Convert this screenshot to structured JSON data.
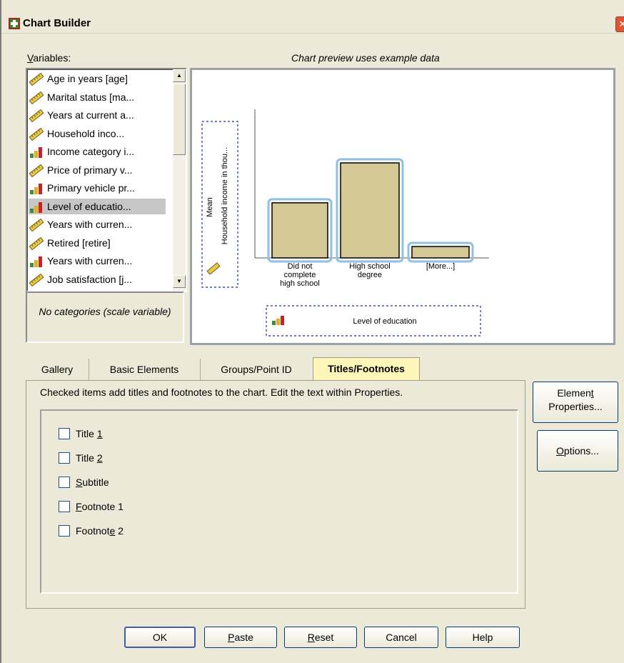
{
  "window": {
    "title": "Chart Builder",
    "close_glyph": "✕"
  },
  "variables": {
    "label": "Variables:",
    "items": [
      {
        "label": "Age in years [age]",
        "icon": "scale-ruler-icon"
      },
      {
        "label": "Marital status [ma...",
        "icon": "scale-ruler-icon"
      },
      {
        "label": "Years at current a...",
        "icon": "scale-ruler-icon"
      },
      {
        "label": "Household inco...",
        "icon": "scale-ruler-icon"
      },
      {
        "label": "Income category i...",
        "icon": "ordinal-bars-icon"
      },
      {
        "label": "Price of primary v...",
        "icon": "scale-ruler-icon"
      },
      {
        "label": "Primary vehicle pr...",
        "icon": "ordinal-bars-icon"
      },
      {
        "label": "Level of educatio...",
        "icon": "ordinal-bars-icon",
        "selected": true
      },
      {
        "label": "Years with curren...",
        "icon": "scale-ruler-icon"
      },
      {
        "label": "Retired [retire]",
        "icon": "scale-ruler-icon"
      },
      {
        "label": "Years with curren...",
        "icon": "ordinal-bars-icon"
      },
      {
        "label": "Job satisfaction [j...",
        "icon": "scale-ruler-icon"
      }
    ],
    "categories_note": "No categories (scale variable)"
  },
  "preview": {
    "label": "Chart preview uses example data",
    "chart_data": {
      "type": "bar",
      "categories": [
        "Did not complete high school",
        "High school degree",
        "[More...]"
      ],
      "category_lines": [
        [
          "Did not",
          "complete",
          "high school"
        ],
        [
          "High school",
          "degree"
        ],
        [
          "[More...]"
        ]
      ],
      "values": [
        0.58,
        1.0,
        0.12
      ],
      "ylabel_line1": "Mean",
      "ylabel_line2": "Household income in thou...",
      "xlabel": "Level of education",
      "bar_color": "#d4c896",
      "highlight_color": "#8ec0e4"
    }
  },
  "tabs": [
    {
      "label": "Gallery"
    },
    {
      "label": "Basic Elements"
    },
    {
      "label": "Groups/Point ID"
    },
    {
      "label": "Titles/Footnotes",
      "active": true
    }
  ],
  "panel": {
    "description": "Checked items add titles and footnotes to the chart. Edit the text within Properties.",
    "checkboxes": [
      {
        "pre": "Title ",
        "u": "1",
        "post": "",
        "checked": false
      },
      {
        "pre": "Title ",
        "u": "2",
        "post": "",
        "checked": false
      },
      {
        "pre": "",
        "u": "S",
        "post": "ubtitle",
        "checked": false
      },
      {
        "pre": "",
        "u": "F",
        "post": "ootnote 1",
        "checked": false
      },
      {
        "pre": "Footnot",
        "u": "e",
        "post": " 2",
        "checked": false
      }
    ]
  },
  "side_buttons": {
    "element_properties": {
      "l1_pre": "Elemen",
      "l1_u": "t",
      "l2": "Properties..."
    },
    "options": {
      "pre": "",
      "u": "O",
      "post": "ptions..."
    }
  },
  "footer": {
    "ok": {
      "pre": "OK",
      "u": "",
      "post": ""
    },
    "paste": {
      "pre": "",
      "u": "P",
      "post": "aste"
    },
    "reset": {
      "pre": "",
      "u": "R",
      "post": "eset"
    },
    "cancel": {
      "pre": "Cancel",
      "u": "",
      "post": ""
    },
    "help": {
      "pre": "Help",
      "u": "",
      "post": ""
    }
  }
}
